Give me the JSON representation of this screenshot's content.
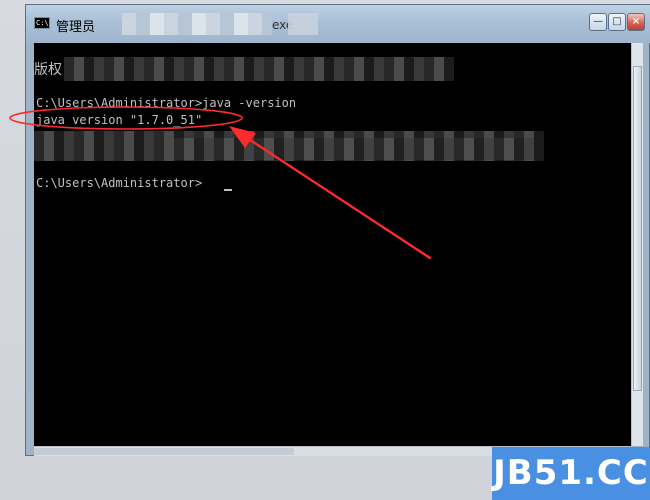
{
  "window": {
    "title": "管理员",
    "title_suffix": "exe",
    "controls": {
      "minimize": "—",
      "maximize": "□",
      "close": "×"
    }
  },
  "console": {
    "copyright_prefix": "版权",
    "lines": {
      "prompt1": "C:\\Users\\Administrator>java -version",
      "version": "java version \"1.7.0_51\"",
      "prompt2": "C:\\Users\\Administrator>"
    }
  },
  "annotation": {
    "color": "#ff2a2a"
  },
  "watermark": {
    "text": "JB51.CC",
    "color": "#4a90e2"
  },
  "icons": {
    "app_icon": "console-icon",
    "arrow": "red-arrow-icon"
  }
}
